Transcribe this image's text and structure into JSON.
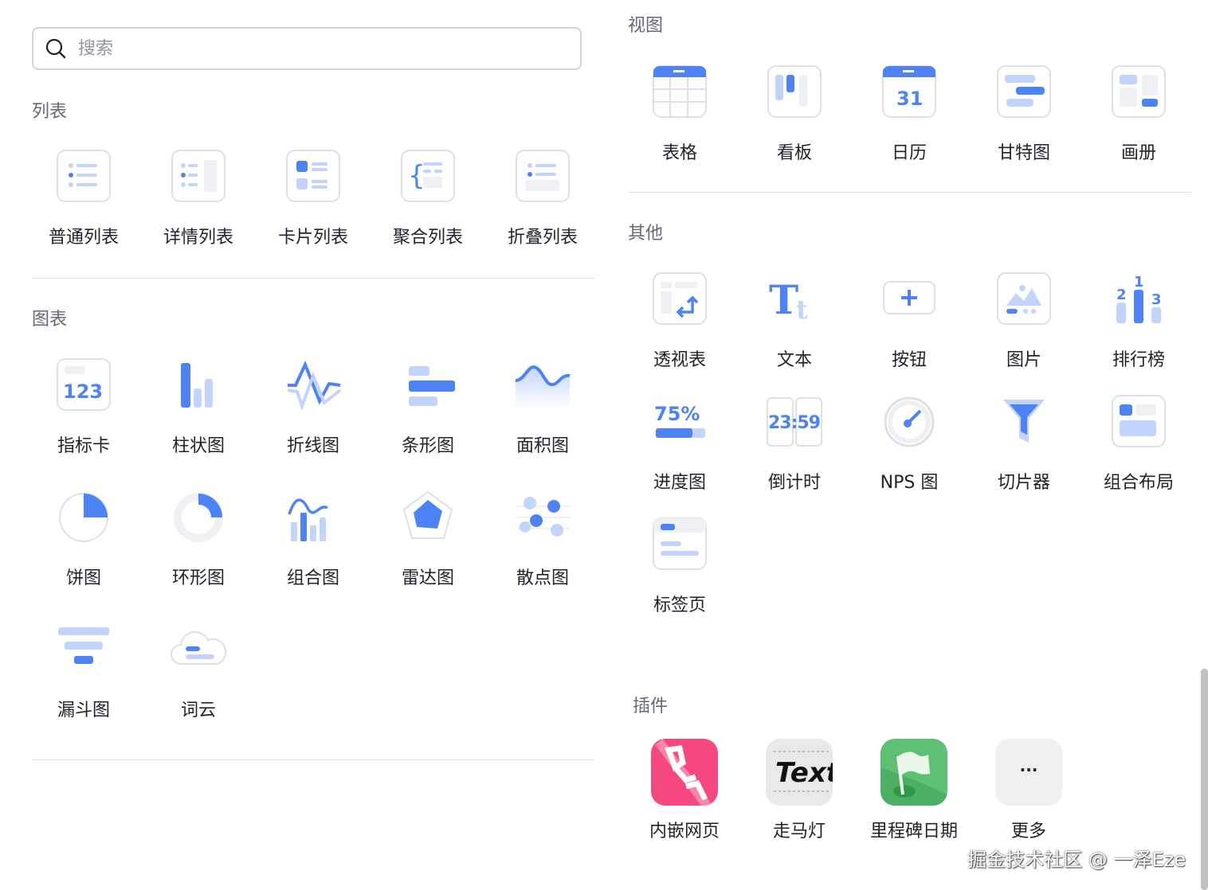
{
  "search": {
    "placeholder": "搜索",
    "value": ""
  },
  "left": {
    "list_section": {
      "title": "列表",
      "items": [
        {
          "label": "普通列表",
          "icon": "list"
        },
        {
          "label": "详情列表",
          "icon": "detail-list"
        },
        {
          "label": "卡片列表",
          "icon": "card-list"
        },
        {
          "label": "聚合列表",
          "icon": "group-list"
        },
        {
          "label": "折叠列表",
          "icon": "fold-list"
        }
      ]
    },
    "chart_section": {
      "title": "图表",
      "items": [
        {
          "label": "指标卡",
          "icon": "metric",
          "text": "123"
        },
        {
          "label": "柱状图",
          "icon": "bar"
        },
        {
          "label": "折线图",
          "icon": "line"
        },
        {
          "label": "条形图",
          "icon": "hbar"
        },
        {
          "label": "面积图",
          "icon": "area"
        },
        {
          "label": "饼图",
          "icon": "pie"
        },
        {
          "label": "环形图",
          "icon": "donut"
        },
        {
          "label": "组合图",
          "icon": "combo"
        },
        {
          "label": "雷达图",
          "icon": "radar"
        },
        {
          "label": "散点图",
          "icon": "scatter"
        },
        {
          "label": "漏斗图",
          "icon": "funnel"
        },
        {
          "label": "词云",
          "icon": "cloud"
        }
      ]
    }
  },
  "right": {
    "view_section": {
      "title": "视图",
      "items": [
        {
          "label": "表格",
          "icon": "table"
        },
        {
          "label": "看板",
          "icon": "kanban"
        },
        {
          "label": "日历",
          "icon": "calendar",
          "text": "31"
        },
        {
          "label": "甘特图",
          "icon": "gantt"
        },
        {
          "label": "画册",
          "icon": "gallery"
        }
      ]
    },
    "other_section": {
      "title": "其他",
      "items": [
        {
          "label": "透视表",
          "icon": "pivot"
        },
        {
          "label": "文本",
          "icon": "text"
        },
        {
          "label": "按钮",
          "icon": "button"
        },
        {
          "label": "图片",
          "icon": "image"
        },
        {
          "label": "排行榜",
          "icon": "ranking"
        },
        {
          "label": "进度图",
          "icon": "progress",
          "text": "75%"
        },
        {
          "label": "倒计时",
          "icon": "countdown",
          "text": "23:59"
        },
        {
          "label": "NPS 图",
          "icon": "nps"
        },
        {
          "label": "切片器",
          "icon": "slicer"
        },
        {
          "label": "组合布局",
          "icon": "layout"
        },
        {
          "label": "标签页",
          "icon": "tabs"
        }
      ]
    },
    "plugin_section": {
      "title": "插件",
      "items": [
        {
          "label": "内嵌网页",
          "icon": "embed-link"
        },
        {
          "label": "走马灯",
          "icon": "marquee",
          "text": "Text"
        },
        {
          "label": "里程碑日期",
          "icon": "milestone-flag"
        },
        {
          "label": "更多",
          "icon": "more",
          "text": "···"
        }
      ]
    }
  },
  "watermark": "掘金技术社区 @ 一泽Eze",
  "colors": {
    "accent": "#4e83f5",
    "light": "#c2d4fb",
    "pink": "#f5497e",
    "green": "#4caf64"
  }
}
